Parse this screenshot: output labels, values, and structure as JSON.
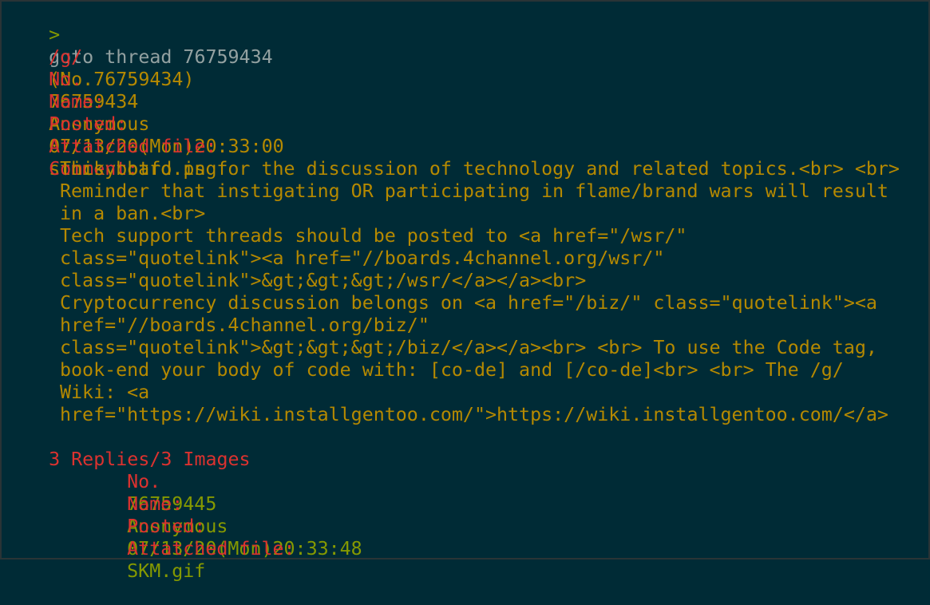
{
  "prompt": {
    "symbol": ">",
    "command": "goto thread 76759434"
  },
  "thread": {
    "board": "/g/",
    "board_no": "(No.76759434)",
    "no_label": "No.",
    "no_value": "76759434",
    "name_label": "Name:",
    "name_value": "Anonymous",
    "posted_label": "Posted:",
    "posted_value": "07/13/20(Mon)20:33:00",
    "file_label": "Attatched file:",
    "file_value": "sticky btfo.png",
    "comment_label": "Comment:",
    "comment_lines": [
      "This board is for the discussion of technology and related topics.<br> <br>",
      "Reminder that instigating OR participating in flame/brand wars will result",
      "in a ban.<br>",
      "Tech support threads should be posted to <a href=\"/wsr/\"",
      "class=\"quotelink\"><a href=\"//boards.4channel.org/wsr/\"",
      "class=\"quotelink\">&gt;&gt;&gt;/wsr/</a></a><br>",
      "Cryptocurrency discussion belongs on <a href=\"/biz/\" class=\"quotelink\"><a",
      "href=\"//boards.4channel.org/biz/\"",
      "class=\"quotelink\">&gt;&gt;&gt;/biz/</a></a><br> <br> To use the Code tag,",
      "book-end your body of code with: [co-de] and [/co-de]<br> <br> The /g/",
      "Wiki: <a",
      "href=\"https://wiki.installgentoo.com/\">https://wiki.installgentoo.com/</a>"
    ],
    "replies_summary": "3 Replies/3 Images"
  },
  "reply": {
    "no_label": "No.",
    "no_value": "76759445",
    "name_label": "Name:",
    "name_value": "Anonymous",
    "posted_label": "Posted:",
    "posted_value": "07/13/20(Mon)20:33:48",
    "file_label": "Attatched file:",
    "file_value": "SKM.gif"
  },
  "colors": {
    "background": "#002b36",
    "label": "#dc322f",
    "value": "#b58900",
    "reply_value": "#859900",
    "prompt": "#859900",
    "command": "#93a1a1"
  }
}
